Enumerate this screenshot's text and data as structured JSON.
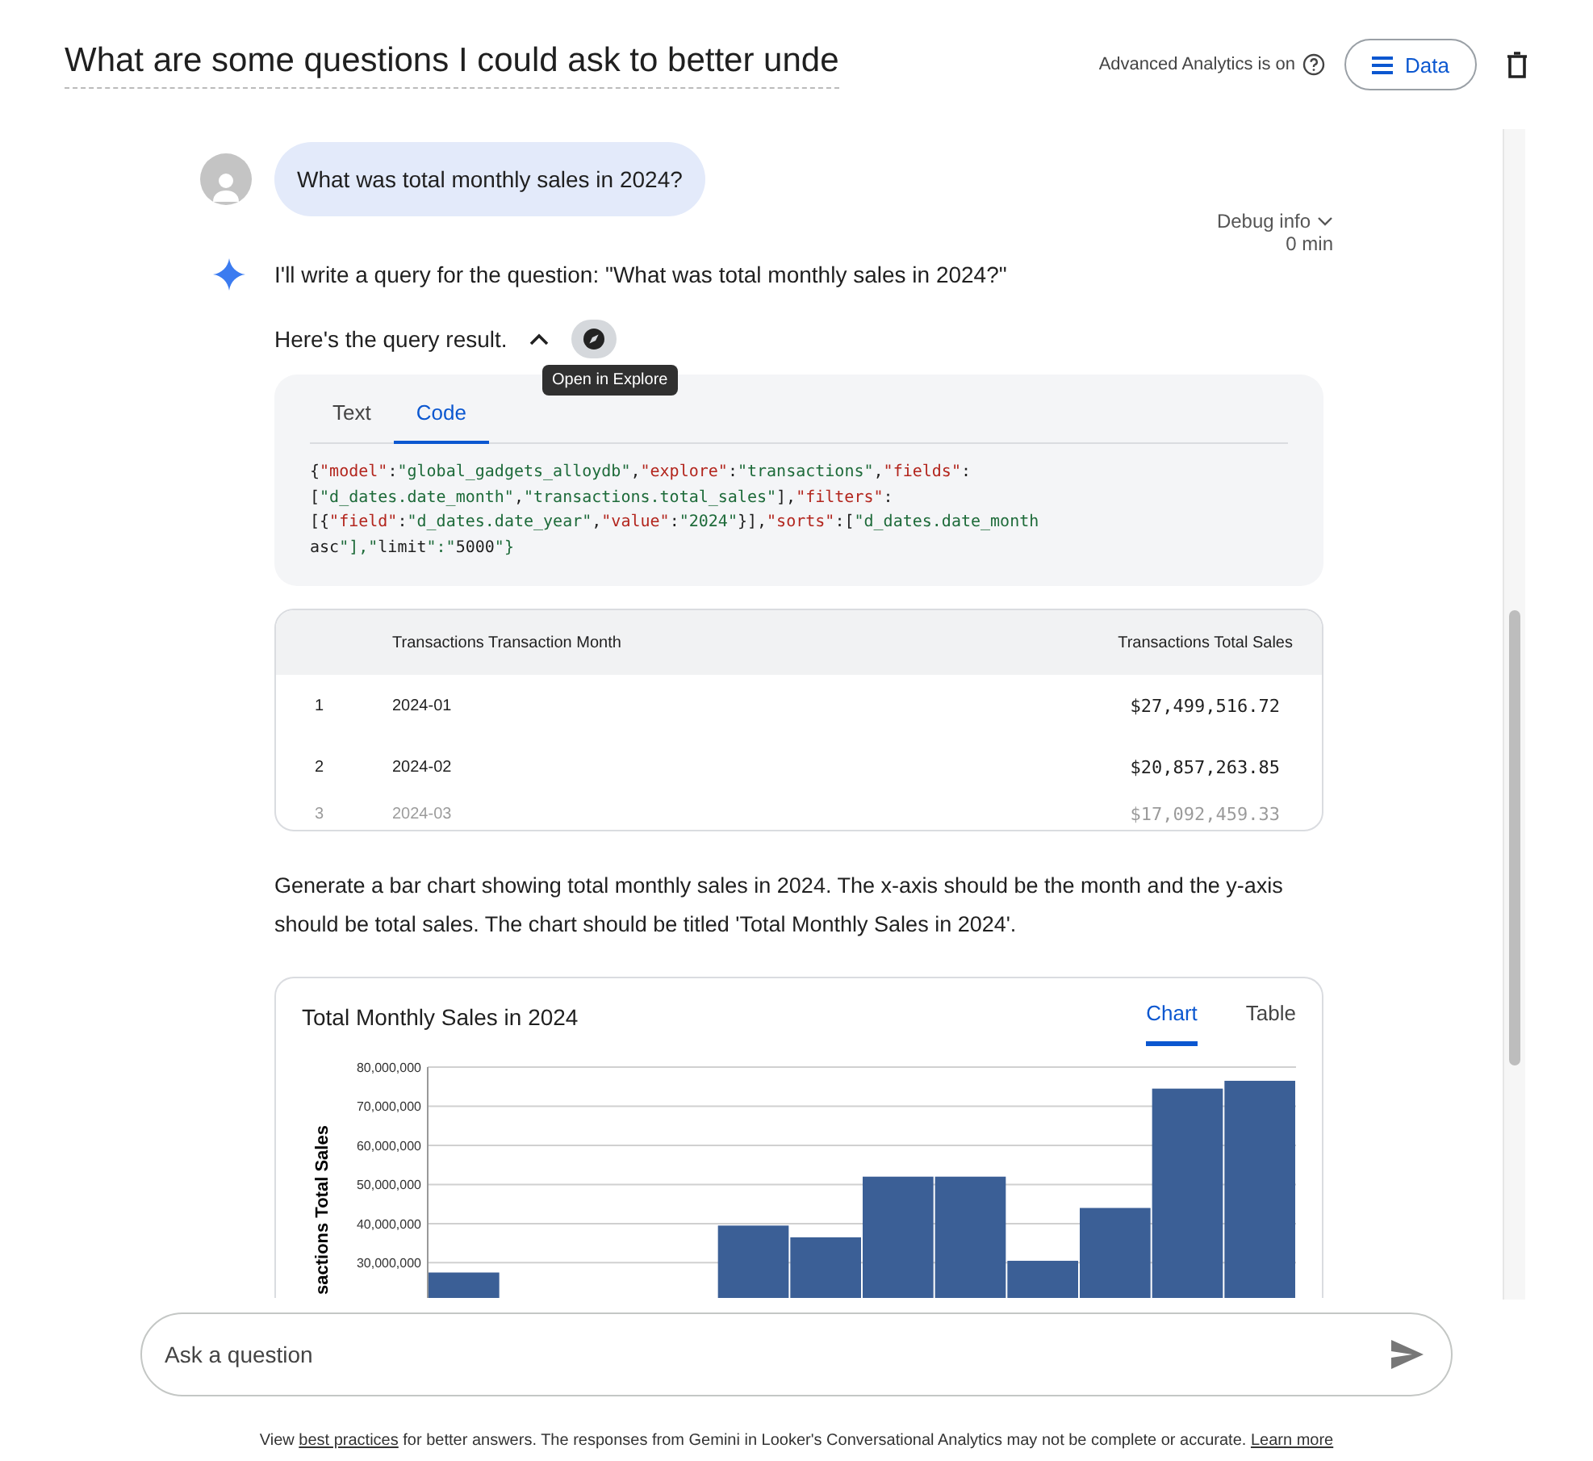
{
  "header": {
    "title": "What are some questions I could ask to better unde",
    "analytics_status": "Advanced Analytics is on",
    "data_button": "Data"
  },
  "conversation": {
    "user_message": "What was total monthly sales in 2024?",
    "debug": {
      "label": "Debug info",
      "time": "0 min"
    },
    "reply_intro": "I'll write a query for the question: \"What was total monthly sales in 2024?\"",
    "result_label": "Here's the query result.",
    "tooltip": "Open in Explore",
    "code_tabs": [
      {
        "label": "Text",
        "selected": false
      },
      {
        "label": "Code",
        "selected": true
      }
    ],
    "code_lines": [
      "{\"model\":\"global_gadgets_alloydb\",\"explore\":\"transactions\",\"fields\":",
      "[\"d_dates.date_month\",\"transactions.total_sales\"],\"filters\":",
      "[{\"field\":\"d_dates.date_year\",\"value\":\"2024\"}],\"sorts\":[\"d_dates.date_month",
      "asc\"],\"limit\":\"5000\"}"
    ],
    "table": {
      "columns": [
        "Transactions Transaction Month",
        "Transactions Total Sales"
      ],
      "rows": [
        {
          "index": "1",
          "month": "2024-01",
          "sales": "$27,499,516.72"
        },
        {
          "index": "2",
          "month": "2024-02",
          "sales": "$20,857,263.85"
        },
        {
          "index": "3",
          "month": "2024-03",
          "sales": "$17,092,459.33"
        }
      ]
    },
    "prompt": "Generate a bar chart showing total monthly sales in 2024. The x-axis should be the month and the y-axis should be total sales. The chart should be titled 'Total Monthly Sales in 2024'.",
    "chart_card": {
      "title": "Total Monthly Sales in 2024",
      "tabs": [
        {
          "label": "Chart",
          "selected": true
        },
        {
          "label": "Table",
          "selected": false
        }
      ],
      "chart_data": {
        "type": "bar",
        "grid": true,
        "ylabel": "sactions Total Sales",
        "ylim": [
          21000000,
          80000000
        ],
        "yticks": [
          {
            "value": 30000000,
            "label": "30,000,000"
          },
          {
            "value": 40000000,
            "label": "40,000,000"
          },
          {
            "value": 50000000,
            "label": "50,000,000"
          },
          {
            "value": 60000000,
            "label": "60,000,000"
          },
          {
            "value": 70000000,
            "label": "70,000,000"
          },
          {
            "value": 80000000,
            "label": "80,000,000"
          }
        ],
        "series": [
          {
            "color": "#3b5f96",
            "values": [
              27500000,
              null,
              null,
              null,
              39500000,
              36500000,
              52000000,
              52000000,
              30500000,
              44000000,
              74500000,
              76500000
            ]
          }
        ]
      }
    }
  },
  "input": {
    "placeholder": "Ask a question"
  },
  "footer": [
    {
      "kind": "text",
      "text": "View "
    },
    {
      "kind": "link",
      "text": "best practices"
    },
    {
      "kind": "text",
      "text": " for better answers. The responses from Gemini in Looker's Conversational Analytics may not be complete or accurate. "
    },
    {
      "kind": "link",
      "text": "Learn more"
    }
  ]
}
